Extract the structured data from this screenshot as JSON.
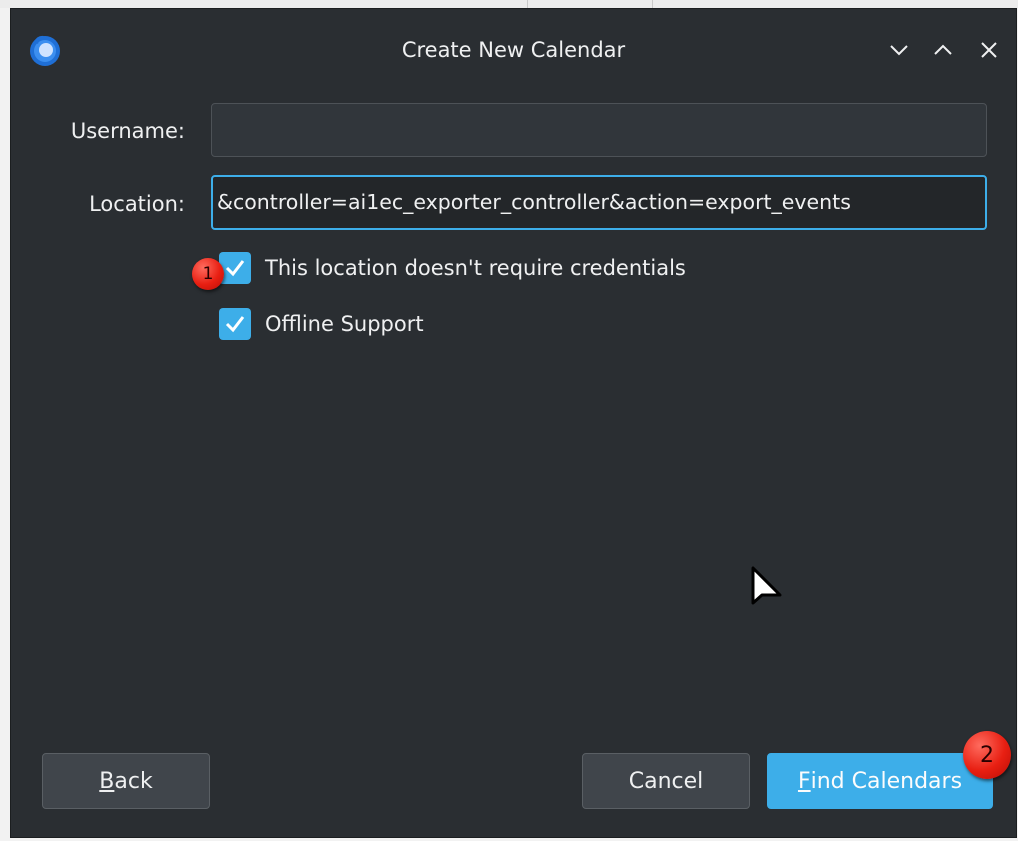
{
  "window": {
    "title": "Create New Calendar"
  },
  "form": {
    "username_label": "Username:",
    "username_value": "",
    "location_label": "Location:",
    "location_value": "&controller=ai1ec_exporter_controller&action=export_events"
  },
  "options": {
    "no_credentials": {
      "label": "This location doesn't require credentials",
      "checked": true
    },
    "offline_support": {
      "label": "Offline Support",
      "checked": true
    }
  },
  "buttons": {
    "back": {
      "mnemonic": "B",
      "rest": "ack"
    },
    "cancel": "Cancel",
    "find": {
      "mnemonic": "F",
      "rest": "ind Calendars"
    }
  },
  "annotations": {
    "badge_1": "1",
    "badge_2": "2"
  },
  "colors": {
    "window_bg": "#2a2e32",
    "accent": "#3daee9",
    "text": "#eff0f1",
    "badge": "#e81f12"
  },
  "icons": {
    "app": "thunderbird-app-icon",
    "minimize": "chevron-down-icon",
    "maximize": "chevron-up-icon",
    "close": "close-icon",
    "check": "check-icon",
    "cursor": "mouse-pointer-icon"
  }
}
